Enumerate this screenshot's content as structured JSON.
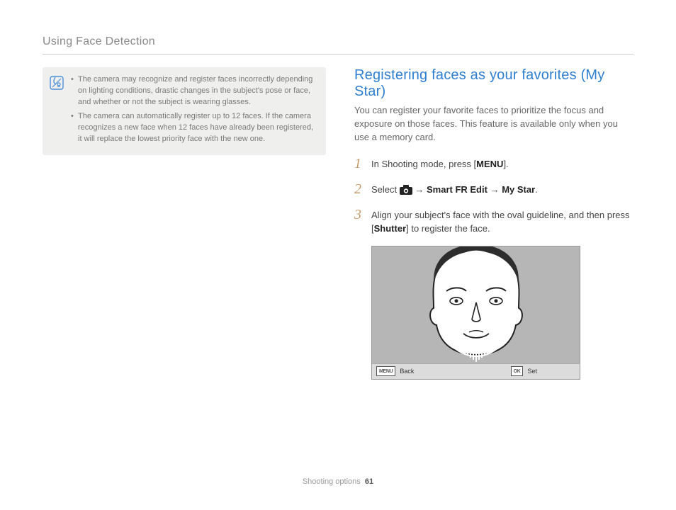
{
  "header": {
    "title": "Using Face Detection"
  },
  "note": {
    "items": [
      "The camera may recognize and register faces incorrectly depending on lighting conditions, drastic changes in the subject's pose or face, and whether or not the subject is wearing glasses.",
      "The camera can automatically register up to 12 faces. If the camera recognizes a new face when 12 faces have already been registered, it will replace the lowest priority face with the new one."
    ]
  },
  "section": {
    "title": "Registering faces as your favorites (My Star)",
    "intro": "You can register your favorite faces to prioritize the focus and exposure on those faces. This feature is available only when you use a memory card."
  },
  "steps": {
    "s1": {
      "num": "1",
      "pre": "In Shooting mode, press [",
      "menu": "MENU",
      "post": "]."
    },
    "s2": {
      "num": "2",
      "select": "Select ",
      "arrow": " → ",
      "smart": "Smart FR Edit",
      "mystar": "My Star",
      "dot": "."
    },
    "s3": {
      "num": "3",
      "pre": "Align your subject's face with the oval guideline, and then press [",
      "shutter": "Shutter",
      "post": "] to register the face."
    }
  },
  "screenshot": {
    "menu_tag": "MENU",
    "back": "Back",
    "ok_tag": "OK",
    "set": "Set"
  },
  "footer": {
    "section": "Shooting options",
    "page": "61"
  }
}
